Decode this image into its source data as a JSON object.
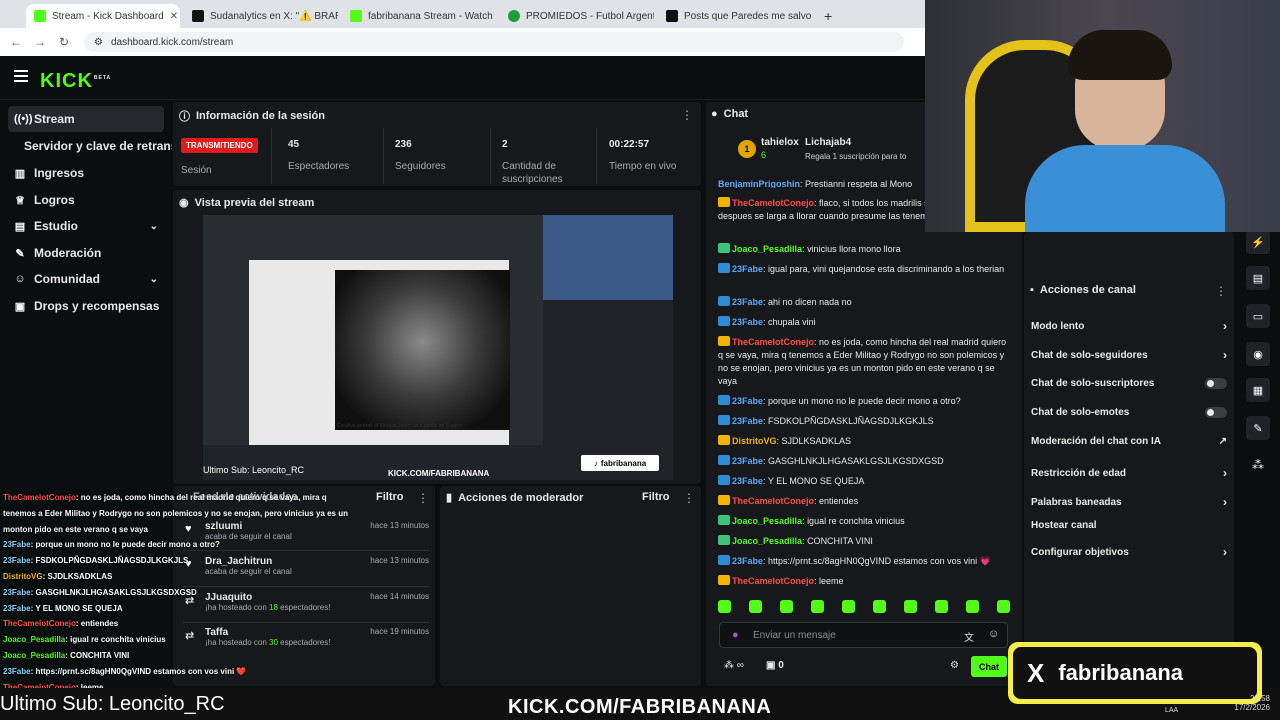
{
  "browser": {
    "tabs": [
      {
        "title": "Stream - Kick Dashboard",
        "color": "#53fc18"
      },
      {
        "title": "Sudanalytics en X: \"⚠️ BRAR VINI",
        "color": "#111111"
      },
      {
        "title": "fabribanana Stream - Watch Li",
        "color": "#53fc18"
      },
      {
        "title": "PROMIEDOS - Futbol Argentino",
        "color": "#1c9c3c"
      },
      {
        "title": "Posts que Paredes me salvo la v",
        "color": "#111111"
      }
    ],
    "new_tab": "+",
    "url": "dashboard.kick.com/stream"
  },
  "header": {
    "logo": "KICK",
    "logo_badge": "BETA"
  },
  "sidebar": {
    "items": [
      {
        "label": "Stream",
        "icon": "broadcast-icon"
      },
      {
        "label": "Servidor y clave de retransmisión",
        "icon": ""
      },
      {
        "label": "Ingresos",
        "icon": "chart-icon"
      },
      {
        "label": "Logros",
        "icon": "trophy-icon"
      },
      {
        "label": "Estudio",
        "icon": "studio-icon",
        "chevron": "⌄"
      },
      {
        "label": "Moderación",
        "icon": "wrench-icon"
      },
      {
        "label": "Comunidad",
        "icon": "users-icon",
        "chevron": "⌄"
      },
      {
        "label": "Drops y recompensas",
        "icon": "gift-icon"
      }
    ]
  },
  "session": {
    "title": "Información de la sesión",
    "live_badge": "TRANSMITIENDO",
    "session_label": "Sesión",
    "stats": [
      {
        "value": "45",
        "label": "Espectadores"
      },
      {
        "value": "236",
        "label": "Seguidores"
      },
      {
        "value": "2",
        "label": "Cantidad de suscripciones"
      },
      {
        "value": "00:22:57",
        "label": "Tiempo en vivo"
      }
    ]
  },
  "preview": {
    "title": "Vista previa del stream",
    "caption": "Creative portrait of Vinicius Júnior as a gorilla on Craiyon",
    "overlay_sub": "Ultimo Sub: Leoncito_RC",
    "overlay_url": "KICK.COM/FABRIBANANA",
    "overlay_tiktok": "fabribanana"
  },
  "activity": {
    "title": "Feed de actividades",
    "filter": "Filtro",
    "items": [
      {
        "name": "szluumi",
        "desc": "acaba de seguir el canal",
        "time": "hace 13 minutos",
        "icon": "heart-icon",
        "count": ""
      },
      {
        "name": "Dra_Jachitrun",
        "desc": "acaba de seguir el canal",
        "time": "hace 13 minutos",
        "icon": "heart-icon",
        "count": ""
      },
      {
        "name": "JJuaquito",
        "desc_pre": "¡ha hosteado con ",
        "count": "18",
        "desc_post": " espectadores!",
        "time": "hace 14 minutos",
        "icon": "host-icon"
      },
      {
        "name": "Taffa",
        "desc_pre": "¡ha hosteado con ",
        "count": "30",
        "desc_post": " espectadores!",
        "time": "hace 19 minutos",
        "icon": "host-icon"
      }
    ]
  },
  "modactions": {
    "title": "Acciones de moderador",
    "filter": "Filtro"
  },
  "chat": {
    "title": "Chat",
    "pinned": {
      "rank": "1",
      "name": "tahielox",
      "sub_count": "6",
      "gifter": "Lichajab4",
      "gift_text": "Regala 1 suscripción para to"
    },
    "messages": [
      {
        "user": "BenjaminPrigoshin",
        "color": "#5aa9ff",
        "text": "Prestianni respeta al Mono",
        "badge": ""
      },
      {
        "user": "TheCamelotConejo",
        "color": "#ff4d4d",
        "text": "flaco, si todos los madrilis se quejan, vini y despues se larga a llorar cuando presume las tenemos",
        "badge": "#f0b400"
      },
      {
        "user": "Joaco_Pesadilla",
        "color": "#53fc18",
        "text": "vinicius llora mono llora",
        "badge": "#3bc47a"
      },
      {
        "user": "23Fabe",
        "color": "#5aa9ff",
        "text": "igual para, vini quejandose esta discriminando a los therian",
        "badge": "#2e8bd6"
      },
      {
        "user": "23Fabe",
        "color": "#5aa9ff",
        "text": "ahi no dicen nada no",
        "badge": "#2e8bd6"
      },
      {
        "user": "23Fabe",
        "color": "#5aa9ff",
        "text": "chupala vini",
        "badge": "#2e8bd6"
      },
      {
        "user": "TheCamelotConejo",
        "color": "#ff4d4d",
        "text": "no es joda, como hincha del real madrid quiero q se vaya, mira q tenemos a Eder Militao y Rodrygo no son polemicos y no se enojan, pero vinicius ya es un monton pido en este verano q se vaya",
        "badge": "#f0b400"
      },
      {
        "user": "23Fabe",
        "color": "#5aa9ff",
        "text": "porque un mono no le puede decir mono a otro?",
        "badge": "#2e8bd6"
      },
      {
        "user": "23Fabe",
        "color": "#5aa9ff",
        "text": "FSDKOLPÑGDASKLJÑAGSDJLKGKJLS",
        "badge": "#2e8bd6"
      },
      {
        "user": "DistritoVG",
        "color": "#f0b400",
        "text": "SJDLKSADKLAS",
        "badge": "#f0b400"
      },
      {
        "user": "23Fabe",
        "color": "#5aa9ff",
        "text": "GASGHLNKJLHGASAKLGSJLKGSDXGSD",
        "badge": "#2e8bd6"
      },
      {
        "user": "23Fabe",
        "color": "#5aa9ff",
        "text": "Y EL MONO SE QUEJA",
        "badge": "#2e8bd6"
      },
      {
        "user": "TheCamelotConejo",
        "color": "#ff4d4d",
        "text": "entiendes",
        "badge": "#f0b400"
      },
      {
        "user": "Joaco_Pesadilla",
        "color": "#53fc18",
        "text": "igual re conchita vinicius",
        "badge": "#3bc47a"
      },
      {
        "user": "Joaco_Pesadilla",
        "color": "#53fc18",
        "text": "CONCHITA VINI",
        "badge": "#3bc47a"
      },
      {
        "user": "23Fabe",
        "color": "#5aa9ff",
        "text": "https://prnt.sc/8agHN0QgVIND estamos con vos vini 💗",
        "badge": "#2e8bd6"
      },
      {
        "user": "TheCamelotConejo",
        "color": "#ff4d4d",
        "text": "leeme",
        "badge": "#f0b400"
      }
    ],
    "input_placeholder": "Enviar un mensaje",
    "points": "∞",
    "gifts": "0",
    "send_label": "Chat"
  },
  "channel_actions": {
    "title": "Acciones de canal",
    "items": [
      {
        "label": "Modo lento",
        "control": "arrow"
      },
      {
        "label": "Chat de solo-seguidores",
        "control": "arrow"
      },
      {
        "label": "Chat de solo-suscriptores",
        "control": "toggle"
      },
      {
        "label": "Chat de solo-emotes",
        "control": "toggle"
      },
      {
        "label": "Moderación del chat con IA",
        "control": "external"
      },
      {
        "label": "Restricción de edad",
        "control": "arrow"
      },
      {
        "label": "Palabras baneadas",
        "control": "arrow"
      },
      {
        "label": "Hostear canal",
        "control": "none"
      },
      {
        "label": "Configurar objetivos",
        "control": "arrow"
      }
    ]
  },
  "overlay_chat": [
    {
      "user": "TheCamelotConejo",
      "text": "no es joda, como hincha del real madrid quiero q se vaya, mira q"
    },
    {
      "user": "",
      "text": "tenemos a Eder Militao y Rodrygo no son polemicos y no se enojan, pero vinicius ya es un"
    },
    {
      "user": "",
      "text": "monton pido en este verano q se vaya"
    },
    {
      "user": "23Fabe",
      "text": "porque un mono no le puede decir mono a otro?"
    },
    {
      "user": "23Fabe",
      "text": "FSDKOLPÑGDASKLJÑAGSDJLKGKJLS"
    },
    {
      "user": "DistritoVG",
      "text": "SJDLKSADKLAS"
    },
    {
      "user": "23Fabe",
      "text": "GASGHLNKJLHGASAKLGSJLKGSDXGSD"
    },
    {
      "user": "23Fabe",
      "text": "Y EL MONO SE QUEJA"
    },
    {
      "user": "TheCamelotConejo",
      "text": "entiendes"
    },
    {
      "user": "Joaco_Pesadilla",
      "text": "igual re conchita vinicius"
    },
    {
      "user": "Joaco_Pesadilla",
      "text": "CONCHITA VINI"
    },
    {
      "user": "23Fabe",
      "text": "https://prnt.sc/8agHN0QgVIND estamos con vos vini ❤️"
    },
    {
      "user": "TheCamelotConejo",
      "text": "leeme"
    }
  ],
  "stream_overlay": {
    "last_sub": "Ultimo Sub: Leoncito_RC",
    "url": "KICK.COM/FABRIBANANA",
    "x_handle": "fabribanana",
    "time": "22:58",
    "date": "17/2/2026",
    "lang": "LAA"
  }
}
